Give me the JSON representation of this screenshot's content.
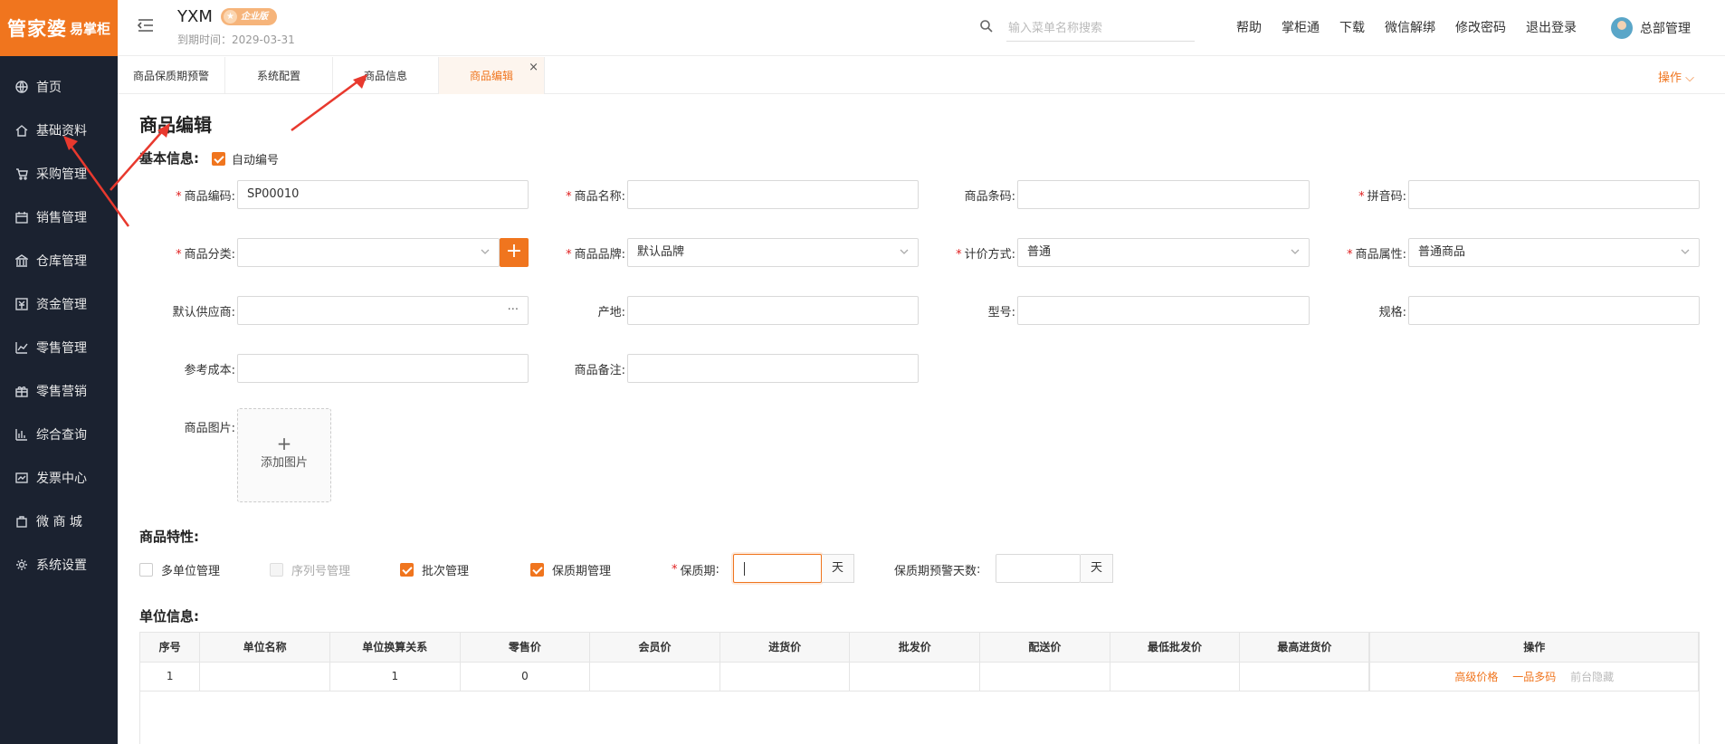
{
  "brand": {
    "logo_main": "管家婆",
    "logo_sub": "易掌柜"
  },
  "sidebar": {
    "items": [
      {
        "label": "首页",
        "icon": "globe-icon"
      },
      {
        "label": "基础资料",
        "icon": "home-icon"
      },
      {
        "label": "采购管理",
        "icon": "cart-icon"
      },
      {
        "label": "销售管理",
        "icon": "calendar-icon"
      },
      {
        "label": "仓库管理",
        "icon": "bank-icon"
      },
      {
        "label": "资金管理",
        "icon": "money-icon"
      },
      {
        "label": "零售管理",
        "icon": "chart-icon"
      },
      {
        "label": "零售营销",
        "icon": "gift-icon"
      },
      {
        "label": "综合查询",
        "icon": "bar-chart-icon"
      },
      {
        "label": "发票中心",
        "icon": "invoice-icon"
      },
      {
        "label": "微 商 城",
        "icon": "bag-icon"
      },
      {
        "label": "系统设置",
        "icon": "gear-icon"
      }
    ]
  },
  "header": {
    "company": "YXM",
    "edition": "企业版",
    "expire": "到期时间：2029-03-31",
    "search_placeholder": "输入菜单名称搜索",
    "links": [
      "帮助",
      "掌柜通",
      "下载",
      "微信解绑",
      "修改密码",
      "退出登录"
    ],
    "user": "总部管理"
  },
  "tabs": {
    "items": [
      {
        "label": "商品保质期预警"
      },
      {
        "label": "系统配置"
      },
      {
        "label": "商品信息"
      },
      {
        "label": "商品编辑",
        "active": true
      }
    ],
    "close": "×",
    "ops": "操作 ⌵"
  },
  "form": {
    "title": "商品编辑",
    "basic_title": "基本信息:",
    "auto_number": "自动编号",
    "fields": {
      "code": {
        "label": "商品编码",
        "value": "SP00010"
      },
      "name": {
        "label": "商品名称",
        "value": ""
      },
      "barcode": {
        "label": "商品条码",
        "value": ""
      },
      "pinyin": {
        "label": "拼音码",
        "value": ""
      },
      "category": {
        "label": "商品分类",
        "value": ""
      },
      "brand": {
        "label": "商品品牌",
        "value": "默认品牌"
      },
      "pricing": {
        "label": "计价方式",
        "value": "普通"
      },
      "attribute": {
        "label": "商品属性",
        "value": "普通商品"
      },
      "supplier": {
        "label": "默认供应商",
        "value": ""
      },
      "origin": {
        "label": "产地",
        "value": ""
      },
      "model": {
        "label": "型号",
        "value": ""
      },
      "spec": {
        "label": "规格",
        "value": ""
      },
      "cost": {
        "label": "参考成本",
        "value": ""
      },
      "remark": {
        "label": "商品备注",
        "value": ""
      },
      "image": {
        "label": "商品图片",
        "upload": "添加图片"
      }
    },
    "features_title": "商品特性:",
    "features": {
      "multi_unit": "多单位管理",
      "serial": "序列号管理",
      "batch": "批次管理",
      "shelf": "保质期管理",
      "shelf_life_label": "保质期",
      "shelf_warn_label": "保质期预警天数",
      "day": "天"
    },
    "unit_title": "单位信息:"
  },
  "unit_table": {
    "headers": [
      "序号",
      "单位名称",
      "单位换算关系",
      "零售价",
      "会员价",
      "进货价",
      "批发价",
      "配送价",
      "最低批发价",
      "最高进货价",
      "操作"
    ],
    "rows": [
      {
        "idx": "1",
        "name": "",
        "ratio": "1",
        "retail": "0",
        "member": "",
        "purchase": "",
        "wholesale": "",
        "delivery": "",
        "min_wholesale": "",
        "max_purchase": ""
      }
    ],
    "actions": [
      "高级价格",
      "一品多码",
      "前台隐藏"
    ]
  },
  "colors": {
    "accent": "#f0751e",
    "sidebar_bg": "#1b2230",
    "annotation": "#e8392e"
  }
}
